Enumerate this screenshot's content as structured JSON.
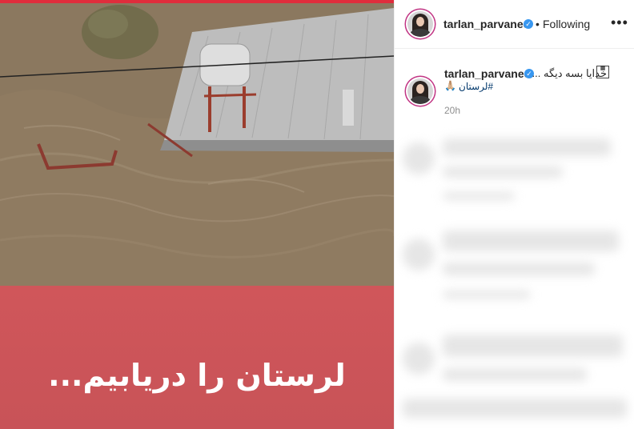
{
  "post": {
    "banner_text": "لرستان را دریابیم..."
  },
  "header": {
    "username": "tarlan_parvanee",
    "separator": "•",
    "follow_status": "Following",
    "more_icon": "more-options-icon"
  },
  "caption": {
    "username": "tarlan_parvanee",
    "text": "خدایا بسه دیگه ...",
    "hashtag": "#لرستان",
    "emoji": "🙏🏼",
    "time_ago": "20h"
  },
  "colors": {
    "banner": "#c95358",
    "verified": "#3897f0",
    "story_ring": "#c13584"
  }
}
